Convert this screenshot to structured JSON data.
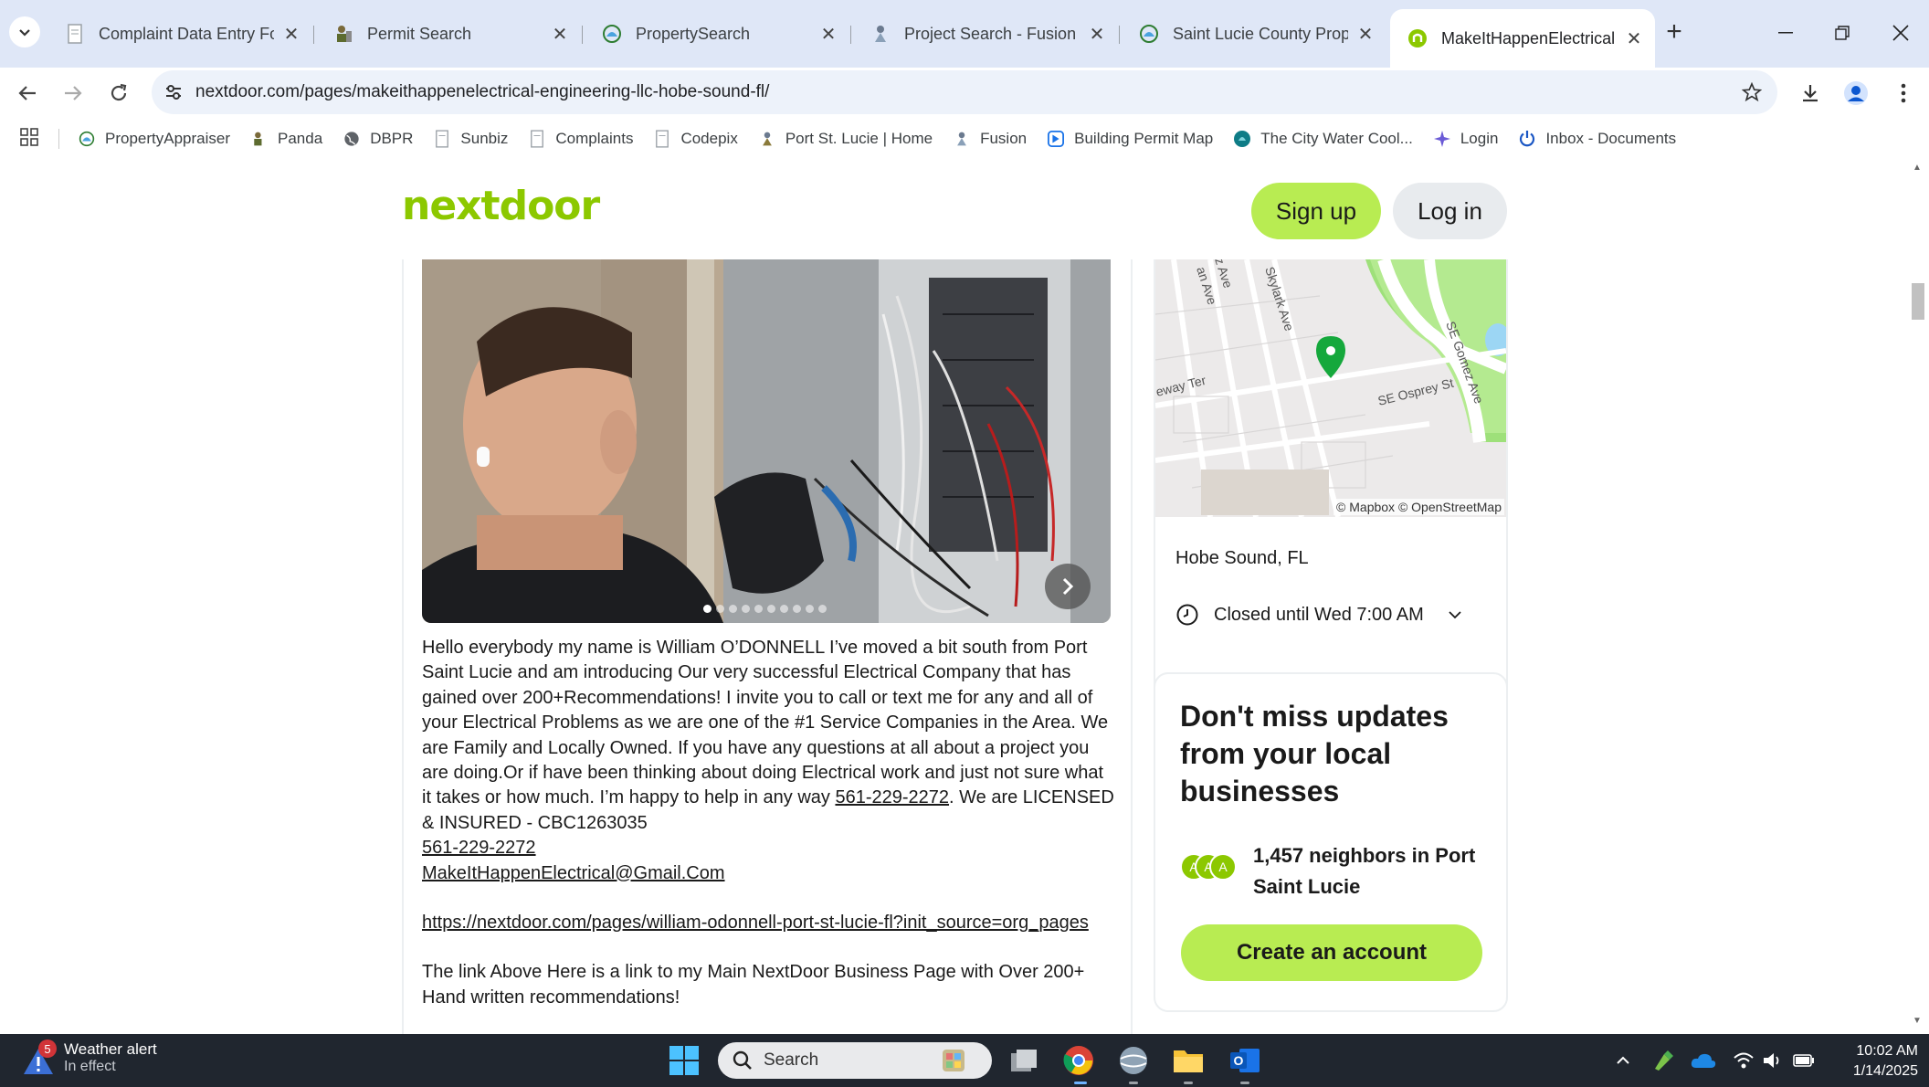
{
  "browser": {
    "tabs": [
      {
        "title": "Complaint Data Entry Form",
        "icon": "document-icon"
      },
      {
        "title": "Permit Search",
        "icon": "worker-icon"
      },
      {
        "title": "PropertySearch",
        "icon": "county-seal-icon"
      },
      {
        "title": "Project Search - Fusion",
        "icon": "worker-icon"
      },
      {
        "title": "Saint Lucie County Propert",
        "icon": "county-seal-icon"
      },
      {
        "title": "MakeItHappenElectrical &",
        "icon": "nextdoor-icon",
        "active": true
      }
    ],
    "url": "nextdoor.com/pages/makeithappenelectrical-engineering-llc-hobe-sound-fl/",
    "bookmarks": [
      {
        "label": "PropertyAppraiser",
        "icon": "county-seal-icon"
      },
      {
        "label": "Panda",
        "icon": "worker-icon"
      },
      {
        "label": "DBPR",
        "icon": "globe-icon"
      },
      {
        "label": "Sunbiz",
        "icon": "document-icon"
      },
      {
        "label": "Complaints",
        "icon": "document-icon"
      },
      {
        "label": "Codepix",
        "icon": "document-icon"
      },
      {
        "label": "Port St. Lucie | Home",
        "icon": "worker-icon"
      },
      {
        "label": "Fusion",
        "icon": "worker-icon"
      },
      {
        "label": "Building Permit Map",
        "icon": "map-app-icon"
      },
      {
        "label": "The City Water Cool...",
        "icon": "water-cooler-icon"
      },
      {
        "label": "Login",
        "icon": "sparkle-icon"
      },
      {
        "label": "Inbox - Documents",
        "icon": "power-icon"
      }
    ]
  },
  "page": {
    "logo": "nextdoor",
    "signup_label": "Sign up",
    "login_label": "Log in",
    "carousel": {
      "dot_count": 10,
      "active_dot": 0
    },
    "description": {
      "p1_before_phone": "Hello everybody my name is William O’DONNELL I’ve moved a bit south from Port Saint Lucie and am introducing Our very successful Electrical Company that has gained over 200+Recommendations! I invite you to call or text me for any and all of your Electrical Problems as we are one of the #1 Service Companies in the Area. We are Family and Locally Owned. If you have any questions at all about a project you are doing.Or if have been thinking about doing Electrical work and just not sure what it takes or how much. I’m happy to help in any way ",
      "phone_inline": "561-229-2272",
      "p1_after_phone": ". We are LICENSED & INSURED - CBC1263035",
      "phone": "561-229-2272",
      "email": "MakeItHappenElectrical@Gmail.Com",
      "link": "https://nextdoor.com/pages/william-odonnell-port-st-lucie-fl?init_source=org_pages",
      "p2": "The link Above Here is a link to my Main  NextDoor Business Page with Over 200+ Hand written recommendations!"
    },
    "map": {
      "attribution": "© Mapbox © OpenStreetMap",
      "street_labels": [
        "SE Osprey St",
        "SE Gomez Ave",
        "Skylark Ave",
        "eway Ter",
        "an Ave",
        "z Ave"
      ]
    },
    "location": "Hobe Sound, FL",
    "hours": "Closed until Wed 7:00 AM",
    "updates": {
      "title": "Don't miss updates from your local businesses",
      "neighbors": "1,457 neighbors in Port Saint Lucie",
      "avatar_letters": [
        "A",
        "A",
        "A"
      ],
      "cta": "Create an account"
    },
    "colors": {
      "brand_green": "#8cc800",
      "button_green": "#b8ec52"
    }
  },
  "taskbar": {
    "weather_badge": "5",
    "weather_title": "Weather alert",
    "weather_subtitle": "In effect",
    "search_placeholder": "Search",
    "time": "10:02 AM",
    "date": "1/14/2025"
  }
}
